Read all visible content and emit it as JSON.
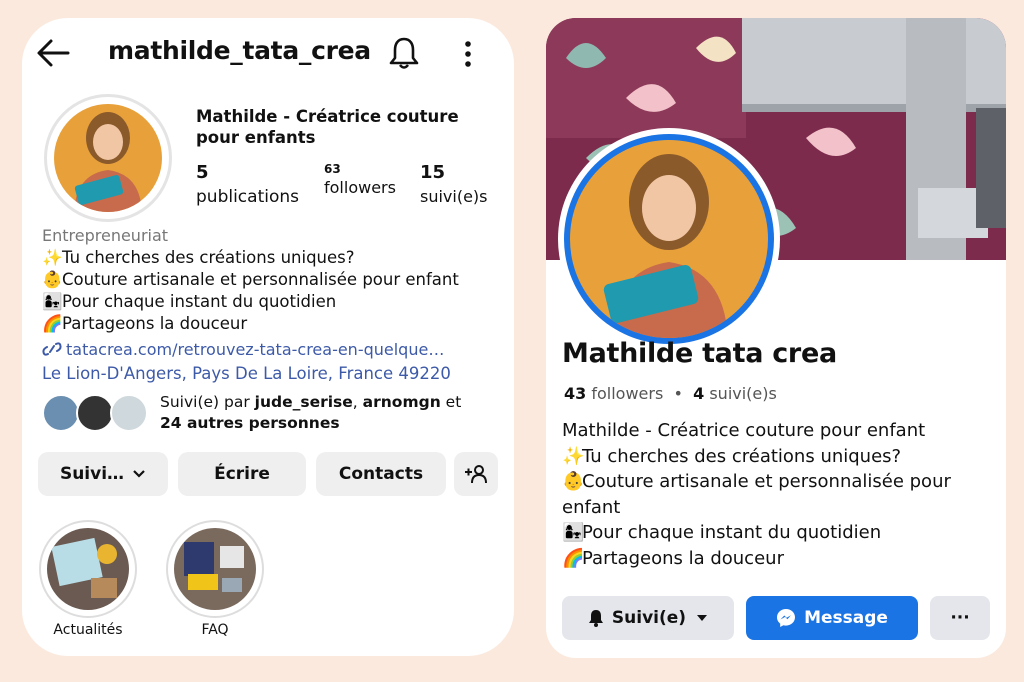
{
  "instagram": {
    "username": "mathilde_tata_crea",
    "name_line1": "Mathilde - Créatrice couture",
    "name_line2": "pour enfants",
    "stats": {
      "posts_num": "5",
      "posts_label": "publications",
      "followers_num": "63",
      "followers_label": "followers",
      "following_num": "15",
      "following_label": "suivi(e)s"
    },
    "category": "Entrepreneuriat",
    "bio": [
      {
        "emoji": "✨",
        "text": "Tu cherches des créations uniques?"
      },
      {
        "emoji": "👶",
        "text": "Couture artisanale et personnalisée pour enfant"
      },
      {
        "emoji": "👩‍👧",
        "text": "Pour chaque instant du quotidien"
      },
      {
        "emoji": "🌈",
        "text": "Partageons la douceur"
      }
    ],
    "link": "tatacrea.com/retrouvez-tata-crea-en-quelque…",
    "location": "Le Lion-D'Angers, Pays De La Loire, France 49220",
    "followed_by_prefix": "Suivi(e) par ",
    "followed_by_users": "jude_serise",
    "followed_by_sep": ", ",
    "followed_by_user2": "arnomgn",
    "followed_by_and": " et",
    "followed_by_others": "24 autres personnes",
    "buttons": {
      "follow": "Suivi…",
      "message": "Écrire",
      "contacts": "Contacts"
    },
    "highlights": [
      {
        "label": "Actualités"
      },
      {
        "label": "FAQ"
      }
    ]
  },
  "facebook": {
    "name": "Mathilde tata crea",
    "followers_num": "43",
    "followers_label": "followers",
    "following_num": "4",
    "following_label": "suivi(e)s",
    "bio": [
      {
        "emoji": "",
        "text": "Mathilde - Créatrice couture pour enfant"
      },
      {
        "emoji": "✨",
        "text": "Tu cherches des créations uniques?"
      },
      {
        "emoji": "👶",
        "text": "Couture artisanale et personnalisée pour"
      },
      {
        "emoji": "",
        "text": "enfant"
      },
      {
        "emoji": "👩‍👧",
        "text": "Pour chaque instant du quotidien"
      },
      {
        "emoji": "🌈",
        "text": "Partageons la douceur"
      }
    ],
    "buttons": {
      "follow": "Suivi(e)",
      "message": "Message",
      "more": "···"
    }
  },
  "colors": {
    "background": "#fbe9dd",
    "ig_link": "#3d5aa8",
    "fb_blue": "#1b74e4"
  }
}
